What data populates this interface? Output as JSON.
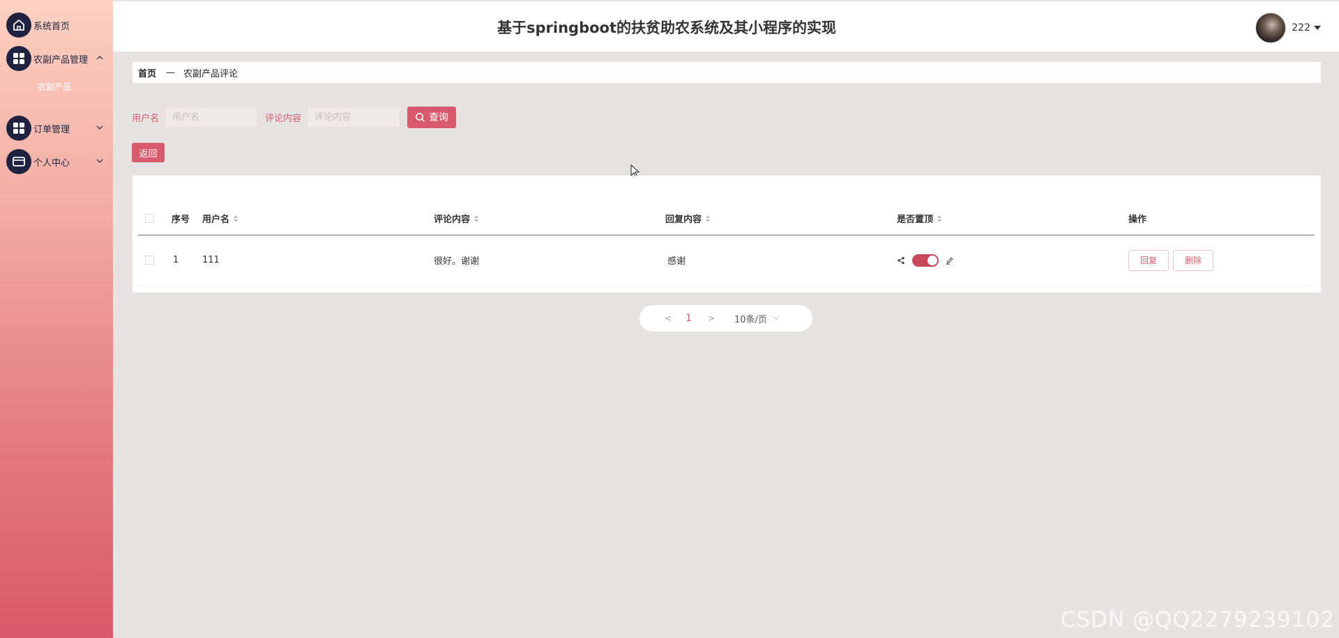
{
  "sidebar": {
    "items": [
      {
        "label": "系统首页",
        "icon": "home-icon"
      },
      {
        "label": "农副产品管理",
        "icon": "grid-icon",
        "expanded": true
      },
      {
        "label": "订单管理",
        "icon": "grid-icon"
      },
      {
        "label": "个人中心",
        "icon": "card-icon"
      }
    ],
    "submenu_label": "农副产品"
  },
  "header": {
    "title": "基于springboot的扶贫助农系统及其小程序的实现",
    "user_name": "222"
  },
  "breadcrumb": {
    "home": "首页",
    "separator": "—",
    "current": "农副产品评论"
  },
  "search": {
    "username_label": "用户名",
    "username_placeholder": "用户名",
    "content_label": "评论内容",
    "content_placeholder": "评论内容",
    "query_label": "查询"
  },
  "back_label": "返回",
  "table": {
    "columns": [
      "序号",
      "用户名",
      "评论内容",
      "回复内容",
      "是否置顶",
      "操作"
    ],
    "rows": [
      {
        "index": "1",
        "username": "111",
        "comment": "很好。谢谢",
        "reply": "感谢",
        "pinned": true
      }
    ],
    "reply_button": "回复",
    "delete_button": "删除"
  },
  "pagination": {
    "prev": "<",
    "current": "1",
    "next": ">",
    "page_size": "10条/页"
  },
  "watermark": "CSDN @QQ2279239102",
  "colors": {
    "accent": "#d75b6c",
    "nav_icon": "#1f2340"
  }
}
